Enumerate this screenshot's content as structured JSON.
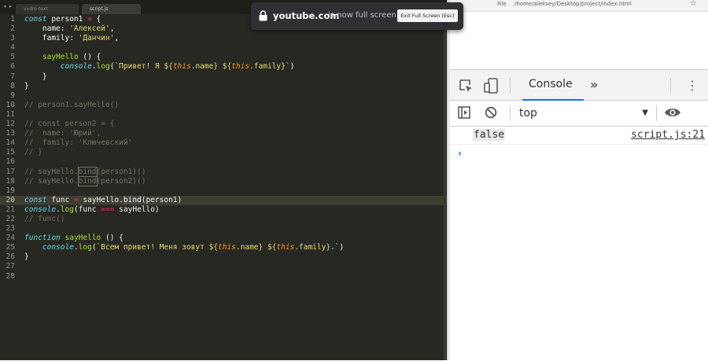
{
  "editor": {
    "tabs": [
      "vvdro text",
      "script.js"
    ],
    "lines": [
      {
        "n": "1",
        "tokens": [
          [
            "kw",
            "const"
          ],
          [
            "t",
            " person1 "
          ],
          [
            "op",
            "="
          ],
          [
            "t",
            " {"
          ]
        ]
      },
      {
        "n": "2",
        "tokens": [
          [
            "t",
            "    name: "
          ],
          [
            "str",
            "'Алексей'"
          ],
          [
            "t",
            ","
          ]
        ]
      },
      {
        "n": "3",
        "tokens": [
          [
            "t",
            "    family: "
          ],
          [
            "str",
            "'Данчин'"
          ],
          [
            "t",
            ","
          ]
        ]
      },
      {
        "n": "4",
        "tokens": []
      },
      {
        "n": "5",
        "tokens": [
          [
            "t",
            "    "
          ],
          [
            "fn",
            "sayHello"
          ],
          [
            "t",
            " () {"
          ]
        ]
      },
      {
        "n": "6",
        "tokens": [
          [
            "t",
            "        "
          ],
          [
            "kw",
            "console"
          ],
          [
            "t",
            "."
          ],
          [
            "fn",
            "log"
          ],
          [
            "t",
            "("
          ],
          [
            "str",
            "`Привет! Я ${"
          ],
          [
            "this",
            "this"
          ],
          [
            "str",
            ".name} ${"
          ],
          [
            "this",
            "this"
          ],
          [
            "str",
            ".family}`"
          ],
          [
            "t",
            ")"
          ]
        ]
      },
      {
        "n": "7",
        "tokens": [
          [
            "t",
            "    }"
          ]
        ]
      },
      {
        "n": "8",
        "tokens": [
          [
            "t",
            "}"
          ]
        ]
      },
      {
        "n": "9",
        "tokens": []
      },
      {
        "n": "10",
        "tokens": [
          [
            "cm",
            "// person1.sayHello()"
          ]
        ]
      },
      {
        "n": "11",
        "tokens": []
      },
      {
        "n": "12",
        "tokens": [
          [
            "cm",
            "// const person2 = {"
          ]
        ]
      },
      {
        "n": "13",
        "tokens": [
          [
            "cm",
            "//  name: 'Юрий',"
          ]
        ]
      },
      {
        "n": "14",
        "tokens": [
          [
            "cm",
            "//  family: 'Ключевский'"
          ]
        ]
      },
      {
        "n": "15",
        "tokens": [
          [
            "cm",
            "// }"
          ]
        ]
      },
      {
        "n": "16",
        "tokens": []
      },
      {
        "n": "17",
        "tokens": [
          [
            "cm",
            "// sayHello."
          ],
          [
            "cmbox",
            "bind"
          ],
          [
            "cm",
            "(person1)()"
          ]
        ]
      },
      {
        "n": "18",
        "tokens": [
          [
            "cm",
            "// sayHello."
          ],
          [
            "cmbox",
            "bind"
          ],
          [
            "cm",
            "(person2)()"
          ]
        ]
      },
      {
        "n": "19",
        "tokens": []
      },
      {
        "n": "20",
        "tokens": [
          [
            "kw",
            "const"
          ],
          [
            "t",
            " func "
          ],
          [
            "op",
            "="
          ],
          [
            "t",
            " sayHello."
          ],
          [
            "sel",
            "bind"
          ],
          [
            "t",
            "(person1)"
          ]
        ],
        "active": true
      },
      {
        "n": "21",
        "tokens": [
          [
            "kw",
            "console"
          ],
          [
            "t",
            "."
          ],
          [
            "fn",
            "log"
          ],
          [
            "t",
            "(func "
          ],
          [
            "op",
            "==="
          ],
          [
            "t",
            " sayHello)"
          ]
        ]
      },
      {
        "n": "22",
        "tokens": [
          [
            "cm",
            "// func()"
          ]
        ]
      },
      {
        "n": "23",
        "tokens": []
      },
      {
        "n": "24",
        "tokens": [
          [
            "kw",
            "function"
          ],
          [
            "t",
            " "
          ],
          [
            "fn",
            "sayHello"
          ],
          [
            "t",
            " () {"
          ]
        ]
      },
      {
        "n": "25",
        "tokens": [
          [
            "t",
            "    "
          ],
          [
            "kw",
            "console"
          ],
          [
            "t",
            "."
          ],
          [
            "fn",
            "log"
          ],
          [
            "t",
            "("
          ],
          [
            "str",
            "`Всем привет! Меня зовут ${"
          ],
          [
            "this",
            "this"
          ],
          [
            "str",
            ".name} ${"
          ],
          [
            "this",
            "this"
          ],
          [
            "str",
            ".family}.`"
          ],
          [
            "t",
            ")"
          ]
        ]
      },
      {
        "n": "26",
        "tokens": [
          [
            "t",
            "}"
          ]
        ]
      },
      {
        "n": "27",
        "tokens": []
      },
      {
        "n": "28",
        "tokens": []
      }
    ]
  },
  "browser": {
    "url_scheme": "File",
    "url": "/home/aleksey/Desktop/project/index.html"
  },
  "devtools": {
    "active_tab": "Console",
    "more_tabs": "»",
    "context": "top",
    "log_value": "false",
    "log_source": "script.js:21",
    "prompt": "›"
  },
  "fullscreen_banner": {
    "domain": "youtube.com",
    "message": "is now full screen",
    "exit_label": "Exit Full Screen (Esc)"
  },
  "colors": {
    "editor_bg": "#272822",
    "keyword": "#66d9ef",
    "string": "#e6db74",
    "function": "#a6e22e",
    "operator": "#f92672",
    "comment": "#75715e",
    "accent": "#1a73e8"
  }
}
